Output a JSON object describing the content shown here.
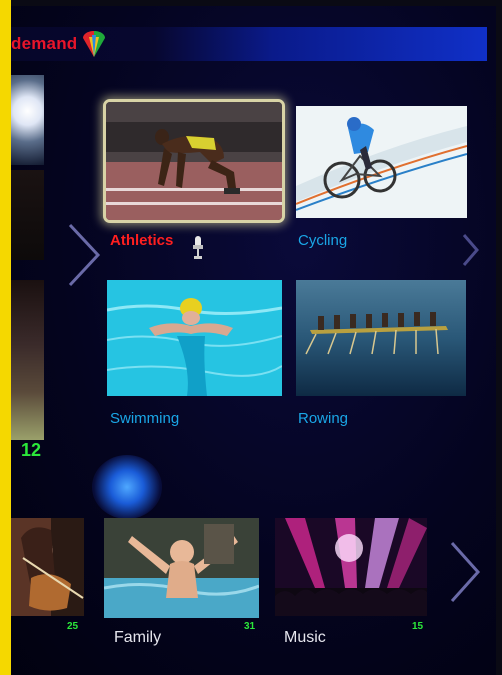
{
  "header": {
    "title": "demand",
    "logo_icon": "multicolor-shield-logo-icon"
  },
  "left_column": {
    "count": "12"
  },
  "sports_grid": {
    "tiles": [
      {
        "label": "Athletics",
        "selected": true,
        "accent": "#ff1f1f",
        "badge_icon": "microphone-icon"
      },
      {
        "label": "Cycling",
        "selected": false,
        "accent": "#1aa6e6"
      },
      {
        "label": "Swimming",
        "selected": false,
        "accent": "#1aa6e6"
      },
      {
        "label": "Rowing",
        "selected": false,
        "accent": "#1aa6e6"
      }
    ]
  },
  "bottom_row": {
    "tiles": [
      {
        "label": "",
        "count": "25"
      },
      {
        "label": "Family",
        "count": "31"
      },
      {
        "label": "Music",
        "count": "15"
      }
    ]
  },
  "colors": {
    "count_green": "#2be83a",
    "frame_yellow": "#f5d800",
    "header_red": "#e8152a"
  }
}
